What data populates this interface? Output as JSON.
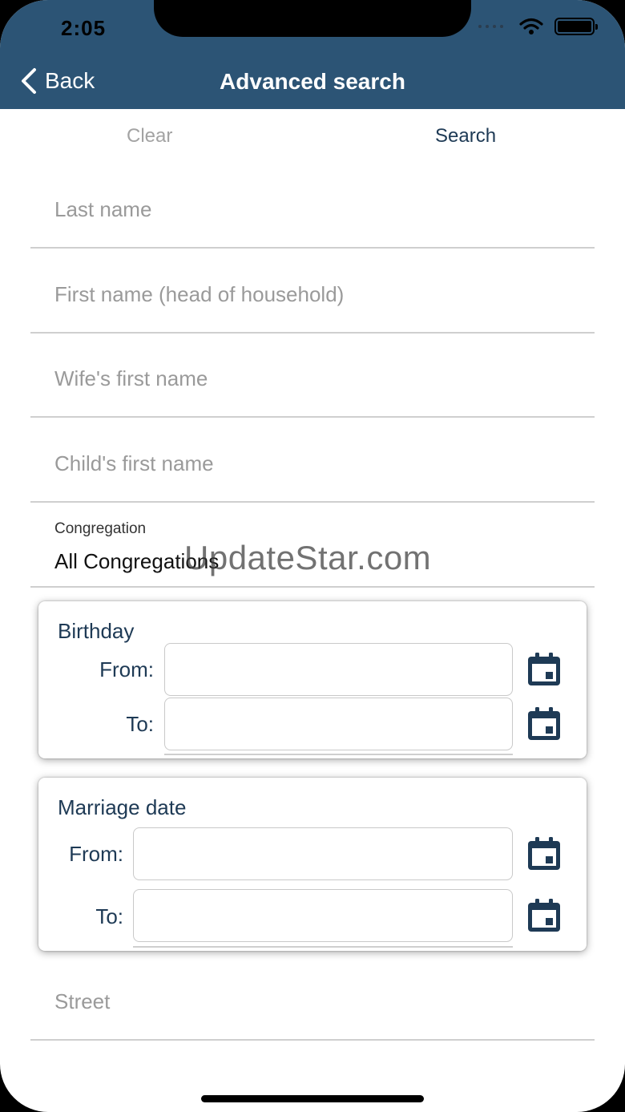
{
  "status_bar": {
    "time": "2:05"
  },
  "nav": {
    "back_label": "Back",
    "title": "Advanced search"
  },
  "actions": {
    "clear_label": "Clear",
    "search_label": "Search"
  },
  "fields": {
    "last_name_placeholder": "Last name",
    "first_name_placeholder": "First name (head of household)",
    "wife_first_name_placeholder": "Wife's first name",
    "child_first_name_placeholder": "Child's first name",
    "street_placeholder": "Street"
  },
  "congregation": {
    "label": "Congregation",
    "value": "All Congregations"
  },
  "birthday": {
    "title": "Birthday",
    "from_label": "From:",
    "to_label": "To:",
    "from_value": "",
    "to_value": ""
  },
  "marriage": {
    "title": "Marriage date",
    "from_label": "From:",
    "to_label": "To:",
    "from_value": "",
    "to_value": ""
  },
  "watermark": "UpdateStar.com",
  "colors": {
    "header": "#2c5475",
    "accent": "#1e3a55",
    "placeholder": "#9a9a9a"
  },
  "icons": [
    "chevron-left-icon",
    "wifi-icon",
    "battery-icon",
    "calendar-icon"
  ]
}
